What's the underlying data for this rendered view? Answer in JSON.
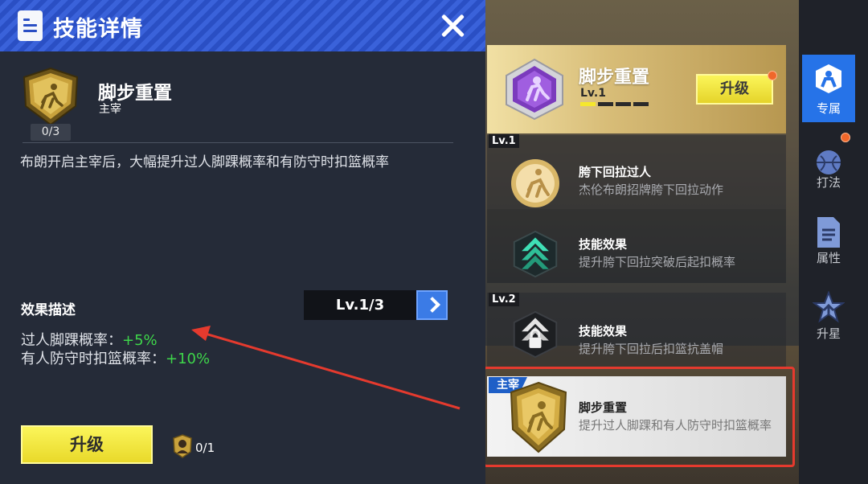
{
  "header": {
    "title": "技能详情"
  },
  "skill": {
    "name": "脚步重置",
    "type": "主宰",
    "count": "0/3",
    "description": "布朗开启主宰后，大幅提升过人脚踝概率和有防守时扣篮概率"
  },
  "effect": {
    "title": "效果描述",
    "level": "Lv.1/3",
    "lines": [
      {
        "label": "过人脚踝概率：",
        "value": "+5%"
      },
      {
        "label": "有人防守时扣篮概率：",
        "value": "+10%"
      }
    ]
  },
  "actions": {
    "upgrade_label": "升级",
    "card_count": "0/1"
  },
  "skill_panel": {
    "name": "脚步重置",
    "level": "Lv.1",
    "level_progress": 0.25,
    "upgrade_label": "升级"
  },
  "tree": {
    "lv1_tag": "Lv.1",
    "lv2_tag": "Lv.2",
    "nodes": [
      {
        "title": "胯下回拉过人",
        "desc": "杰伦布朗招牌胯下回拉动作"
      },
      {
        "title": "技能效果",
        "desc": "提升胯下回拉突破后起扣概率"
      },
      {
        "title": "技能效果",
        "desc": "提升胯下回拉后扣篮抗盖帽"
      }
    ],
    "selected": {
      "tag": "主宰",
      "title": "脚步重置",
      "desc": "提升过人脚踝和有人防守时扣篮概率"
    }
  },
  "sidebar": {
    "tabs": [
      {
        "label": "专属",
        "icon": "exclusive-icon",
        "active": true
      },
      {
        "label": "打法",
        "icon": "playstyle-icon",
        "active": false
      },
      {
        "label": "属性",
        "icon": "attribute-doc-icon",
        "active": false
      },
      {
        "label": "升星",
        "icon": "star-up-icon",
        "active": false
      }
    ]
  },
  "colors": {
    "accent_blue": "#2a4fc4",
    "upgrade_yellow": "#f5ea3a",
    "positive_green": "#3ed64a",
    "highlight_red": "#e53a2e"
  }
}
